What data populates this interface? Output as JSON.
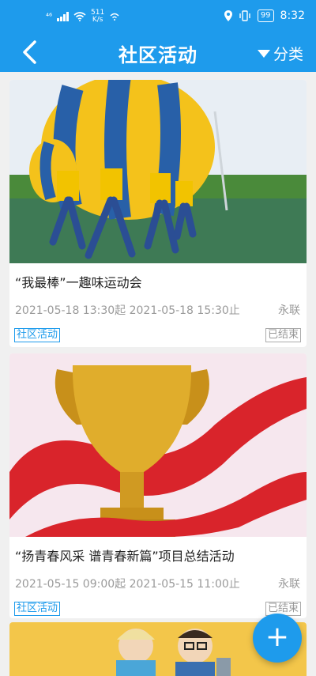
{
  "status_bar": {
    "network": "⁴⁶",
    "speed_value": "511",
    "speed_unit": "K/s",
    "battery": "99",
    "time": "8:32"
  },
  "header": {
    "title": "社区活动",
    "classify_label": "分类"
  },
  "activities": [
    {
      "title": "“我最棒”一趣味运动会",
      "time": "2021-05-18 13:30起 2021-05-18 15:30止",
      "place": "永联",
      "tag": "社区活动",
      "status": "已结束"
    },
    {
      "title": "“扬青春风采 谱青春新篇”项目总结活动",
      "time": "2021-05-15 09:00起 2021-05-15 11:00止",
      "place": "永联",
      "tag": "社区活动",
      "status": "已结束"
    }
  ],
  "fab_label": "+",
  "colors": {
    "primary": "#1e9bec",
    "muted_text": "#9a9a9a",
    "background": "#f0f0f0"
  }
}
